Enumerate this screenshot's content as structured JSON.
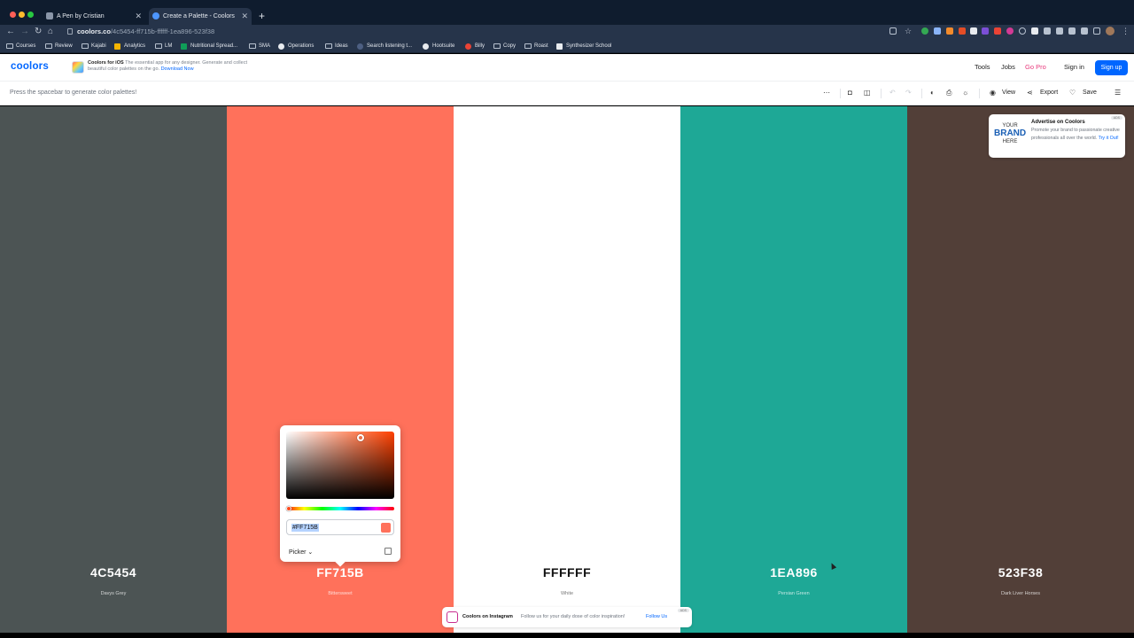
{
  "browser": {
    "tabs": [
      {
        "label": "A Pen by Cristian",
        "active": false
      },
      {
        "label": "Create a Palette - Coolors",
        "active": true
      }
    ],
    "url_host": "coolors.co",
    "url_path": "/4c5454-ff715b-ffffff-1ea896-523f38",
    "bookmarks": [
      "Courses",
      "Review",
      "Kajabi",
      "Analytics",
      "LM",
      "Nutritional Spread...",
      "SMA",
      "Operations",
      "Ideas",
      "Search listening t...",
      "Hootsuite",
      "Billy",
      "Copy",
      "Roast",
      "Synthesizer School"
    ]
  },
  "header": {
    "logo": "coolors",
    "promo_title": "Coolors for iOS",
    "promo_text": "The essential app for any designer. Generate and collect beautiful color palettes on the go.",
    "promo_link": "Download Now",
    "nav": [
      "Tools",
      "Jobs",
      "Go Pro",
      "Sign in"
    ],
    "signup": "Sign up"
  },
  "toolbar": {
    "hint": "Press the spacebar to generate color palettes!",
    "view": "View",
    "export": "Export",
    "save": "Save"
  },
  "palette": [
    {
      "hex": "4C5454",
      "name": "Davys Grey",
      "color": "#4C5454",
      "text_color": "#ffffff"
    },
    {
      "hex": "FF715B",
      "name": "Bittersweet",
      "color": "#FF715B",
      "text_color": "#ffffff"
    },
    {
      "hex": "FFFFFF",
      "name": "White",
      "color": "#FFFFFF",
      "text_color": "#111111"
    },
    {
      "hex": "1EA896",
      "name": "Persian Green",
      "color": "#1EA896",
      "text_color": "#ffffff"
    },
    {
      "hex": "523F38",
      "name": "Dark Liver Horses",
      "color": "#523F38",
      "text_color": "#ffffff"
    }
  ],
  "ad": {
    "brand_line1": "YOUR",
    "brand_line2": "BRAND",
    "brand_line3": "HERE",
    "title": "Advertise on Coolors",
    "text": "Promote your brand to passionate creative professionals all over the world.",
    "link": "Try it Out!",
    "tag": "ADS"
  },
  "picker": {
    "hex_value": "#FF715B",
    "mode": "Picker"
  },
  "instagram": {
    "title": "Coolors on Instagram",
    "text": "Follow us for your daily dose of color inspiration!",
    "link": "Follow Us",
    "tag": "ADS"
  },
  "colors": {
    "brand": "#0066ff",
    "go_pro": "#e8387b"
  }
}
